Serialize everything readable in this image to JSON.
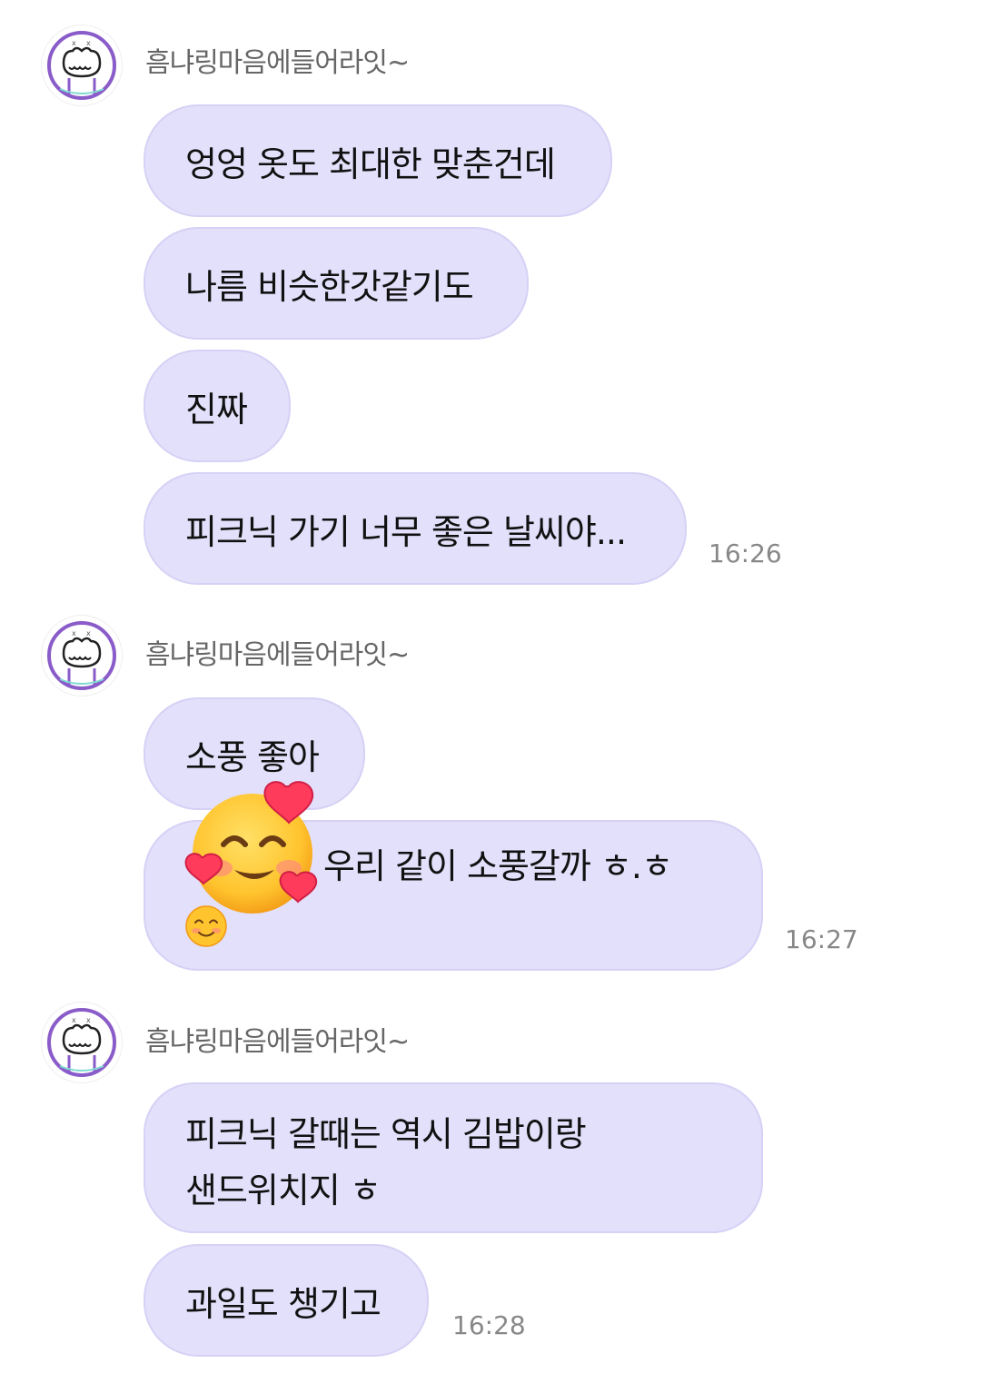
{
  "groups": [
    {
      "sender": "흠냐링마음에들어라잇~",
      "messages": [
        "엉엉 옷도 최대한 맞춘건데",
        "나름 비슷한갓같기도",
        "진짜",
        "피크닉 가기 너무 좋은 날씨야..."
      ],
      "time": "16:26"
    },
    {
      "sender": "흠냐링마음에들어라잇~",
      "messages": [
        "소풍 좋아",
        "우리 같이 소풍갈까 ㅎ.ㅎ"
      ],
      "time": "16:27"
    },
    {
      "sender": "흠냐링마음에들어라잇~",
      "messages": [
        "피크닉 갈때는 역시 김밥이랑",
        "샌드위치지 ㅎ",
        "과일도 챙기고"
      ],
      "time": "16:28"
    }
  ],
  "icons": {
    "avatar": "doodle-face-avatar-icon",
    "emoji_large": "smiling-face-with-hearts-emoji",
    "emoji_small": "smiling-face-emoji"
  },
  "colors": {
    "bubble": "#e3e0fb",
    "bubble_border": "#d6d1f5",
    "avatar_accent": "#8a5cc9"
  }
}
